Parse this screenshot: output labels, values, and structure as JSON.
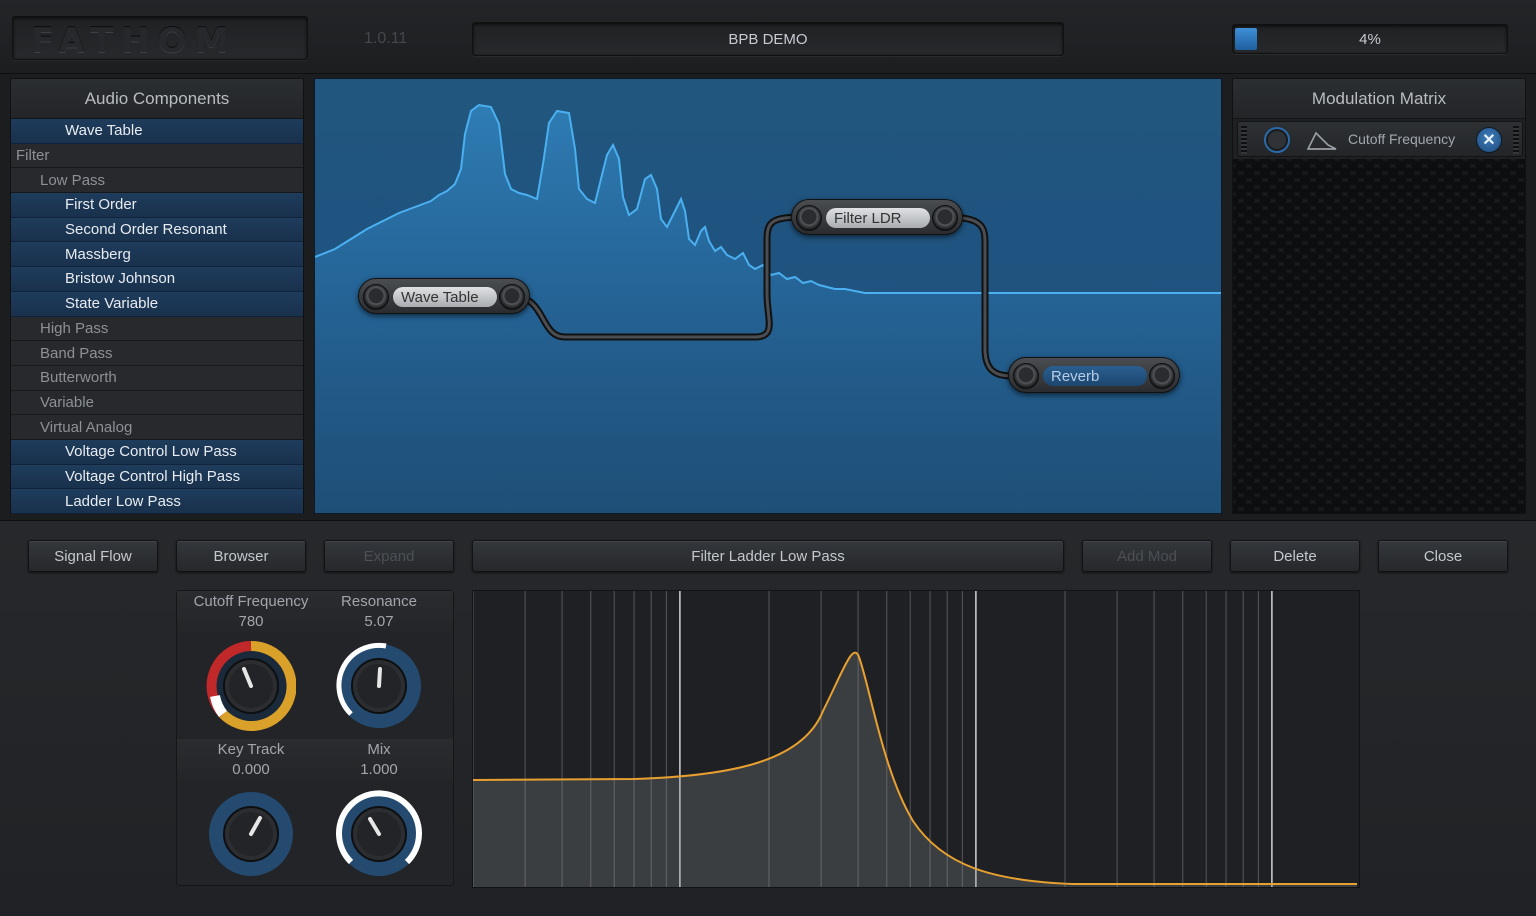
{
  "header": {
    "logo": "FATHOM",
    "version": "1.0.11",
    "preset_name": "BPB DEMO",
    "cpu_usage": "4%",
    "cpu_fraction": 0.04
  },
  "audio_components": {
    "title": "Audio Components",
    "items": [
      {
        "label": "Wave Table",
        "level": 2,
        "selected": true
      },
      {
        "label": "Filter",
        "level": 0,
        "selected": false
      },
      {
        "label": "Low Pass",
        "level": 1,
        "selected": false
      },
      {
        "label": "First Order",
        "level": 2,
        "selected": true
      },
      {
        "label": "Second Order Resonant",
        "level": 2,
        "selected": true
      },
      {
        "label": "Massberg",
        "level": 2,
        "selected": true
      },
      {
        "label": "Bristow Johnson",
        "level": 2,
        "selected": true
      },
      {
        "label": "State Variable",
        "level": 2,
        "selected": true
      },
      {
        "label": "High Pass",
        "level": 1,
        "selected": false
      },
      {
        "label": "Band Pass",
        "level": 1,
        "selected": false
      },
      {
        "label": "Butterworth",
        "level": 1,
        "selected": false
      },
      {
        "label": "Variable",
        "level": 1,
        "selected": false
      },
      {
        "label": "Virtual Analog",
        "level": 1,
        "selected": false
      },
      {
        "label": "Voltage Control Low Pass",
        "level": 2,
        "selected": true
      },
      {
        "label": "Voltage Control High Pass",
        "level": 2,
        "selected": true
      },
      {
        "label": "Ladder Low Pass",
        "level": 2,
        "selected": true
      }
    ]
  },
  "signal_graph": {
    "nodes": {
      "wave_table": "Wave Table",
      "filter_ldr": "Filter LDR",
      "reverb": "Reverb"
    }
  },
  "modulation_matrix": {
    "title": "Modulation Matrix",
    "rows": [
      {
        "target": "Cutoff Frequency",
        "source_icon": "envelope-icon",
        "remove_icon": "close-icon"
      }
    ]
  },
  "toolbar": {
    "signal_flow": "Signal Flow",
    "browser": "Browser",
    "expand": "Expand",
    "selected_component": "Filter Ladder Low Pass",
    "add_mod": "Add Mod",
    "delete": "Delete",
    "close": "Close"
  },
  "knobs": [
    {
      "name": "Cutoff Frequency",
      "value": "780",
      "accent": "#d9a02a"
    },
    {
      "name": "Resonance",
      "value": "5.07",
      "accent": "#ffffff"
    },
    {
      "name": "Key Track",
      "value": "0.000",
      "accent": "#ffffff"
    },
    {
      "name": "Mix",
      "value": "1.000",
      "accent": "#ffffff"
    }
  ],
  "colors": {
    "accent_blue": "#2a6aa8",
    "spectrum_blue": "#3aa0e6",
    "filter_curve": "#e8a030",
    "selected_item": "#1e3c5c"
  }
}
